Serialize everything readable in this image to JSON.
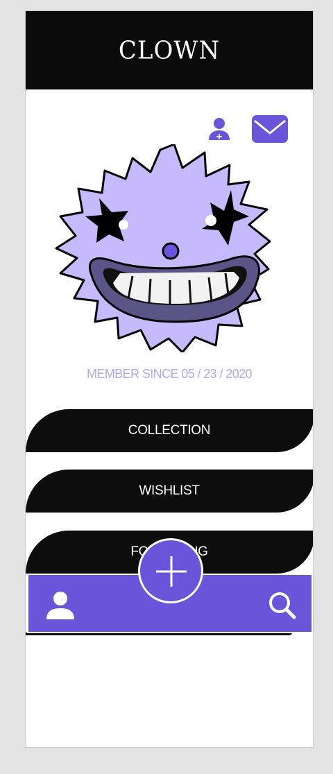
{
  "app": {
    "title": "CLOWN"
  },
  "profile": {
    "member_since": "MEMBER SINCE 05 / 23 / 2020"
  },
  "menu": {
    "items": [
      {
        "label": "COLLECTION"
      },
      {
        "label": "WISHLIST"
      },
      {
        "label": "FOLLOWING"
      }
    ]
  },
  "icons": {
    "header_actions": [
      "add-friend-icon",
      "mail-icon"
    ],
    "bottom_nav": [
      "user-icon",
      "plus-icon",
      "search-icon"
    ]
  },
  "colors": {
    "accent": "#6a55da",
    "mascot_fill": "#c6b9fc",
    "header_bg": "#0b0b0b",
    "member_text": "#b3a8ec"
  }
}
